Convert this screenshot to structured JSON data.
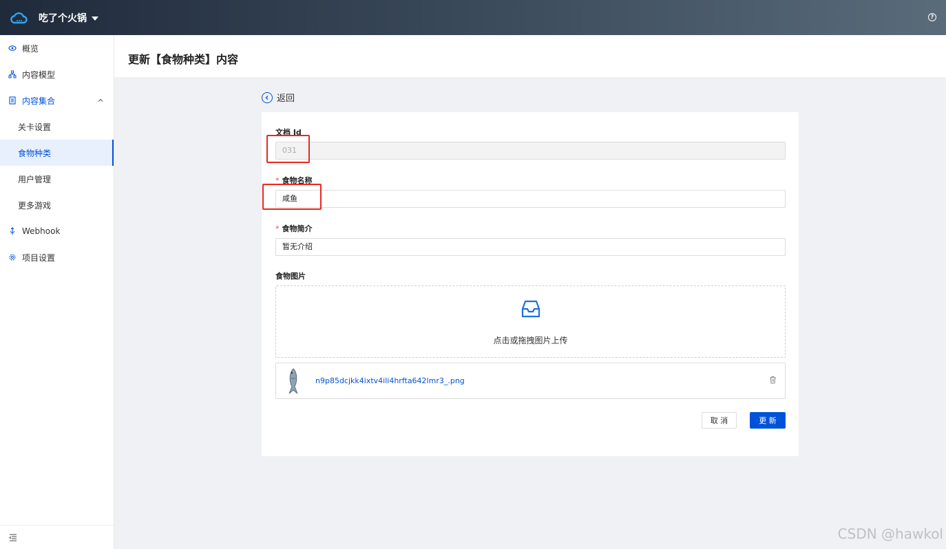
{
  "header": {
    "project_name": "吃了个火锅"
  },
  "sidebar": {
    "items": [
      {
        "label": "概览"
      },
      {
        "label": "内容模型"
      },
      {
        "label": "内容集合"
      },
      {
        "label": "Webhook"
      },
      {
        "label": "项目设置"
      }
    ],
    "sub_items": [
      {
        "label": "关卡设置"
      },
      {
        "label": "食物种类"
      },
      {
        "label": "用户管理"
      },
      {
        "label": "更多游戏"
      }
    ]
  },
  "page": {
    "title": "更新【食物种类】内容",
    "back_label": "返回"
  },
  "form": {
    "doc_id_label": "文档 Id",
    "doc_id_value": "031",
    "name_required_mark": "*",
    "name_label": "食物名称",
    "name_value": "咸鱼",
    "intro_required_mark": "*",
    "intro_label": "食物简介",
    "intro_value": "暂无介绍",
    "image_label": "食物图片",
    "upload_text": "点击或拖拽图片上传",
    "file_name": "n9p85dcjkk4ixtv4ili4hrfta642lmr3_.png",
    "cancel_label": "取 消",
    "submit_label": "更 新"
  },
  "colors": {
    "primary": "#0052d9",
    "highlight": "#e8271f",
    "required": "#e34d59"
  },
  "watermark": "CSDN @hawkol"
}
